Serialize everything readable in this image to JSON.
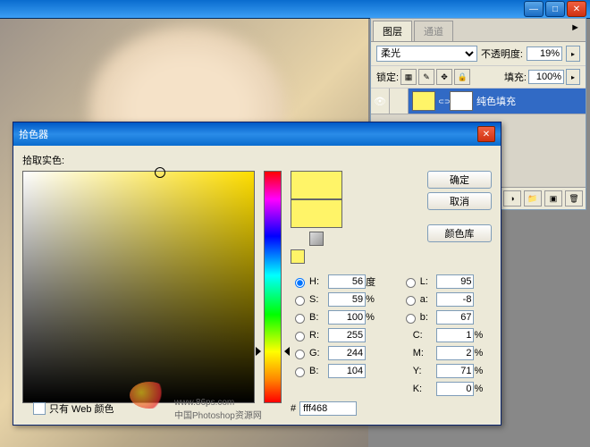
{
  "window": {
    "minimize": "—",
    "maximize": "□",
    "close": "✕"
  },
  "layers": {
    "tab_layers": "图层",
    "tab_channels": "通道",
    "menu": "►",
    "blend_mode": "柔光",
    "opacity_label": "不透明度:",
    "opacity_value": "19%",
    "lock_label": "锁定:",
    "fill_label": "填充:",
    "fill_value": "100%",
    "layer_name": "纯色填充",
    "icons": {
      "eye": "👁",
      "trash": "🗑",
      "new": "▣",
      "folder": "📁",
      "fx": "fx",
      "mask": "◐",
      "adjust": "◑"
    }
  },
  "picker": {
    "title": "拾色器",
    "close": "✕",
    "pick_label": "拾取实色:",
    "ok": "确定",
    "cancel": "取消",
    "library": "颜色库",
    "H": {
      "label": "H:",
      "value": "56",
      "unit": "度"
    },
    "S": {
      "label": "S:",
      "value": "59",
      "unit": "%"
    },
    "Bv": {
      "label": "B:",
      "value": "100",
      "unit": "%"
    },
    "R": {
      "label": "R:",
      "value": "255"
    },
    "G": {
      "label": "G:",
      "value": "244"
    },
    "B": {
      "label": "B:",
      "value": "104"
    },
    "L": {
      "label": "L:",
      "value": "95"
    },
    "a": {
      "label": "a:",
      "value": "-8"
    },
    "b": {
      "label": "b:",
      "value": "67"
    },
    "C": {
      "label": "C:",
      "value": "1",
      "unit": "%"
    },
    "M": {
      "label": "M:",
      "value": "2",
      "unit": "%"
    },
    "Y": {
      "label": "Y:",
      "value": "71",
      "unit": "%"
    },
    "K": {
      "label": "K:",
      "value": "0",
      "unit": "%"
    },
    "hex_label": "#",
    "hex": "fff468",
    "web_only": "只有 Web 颜色"
  },
  "watermark": {
    "url": "www.86ps.com",
    "text": "中国Photoshop资源网"
  }
}
